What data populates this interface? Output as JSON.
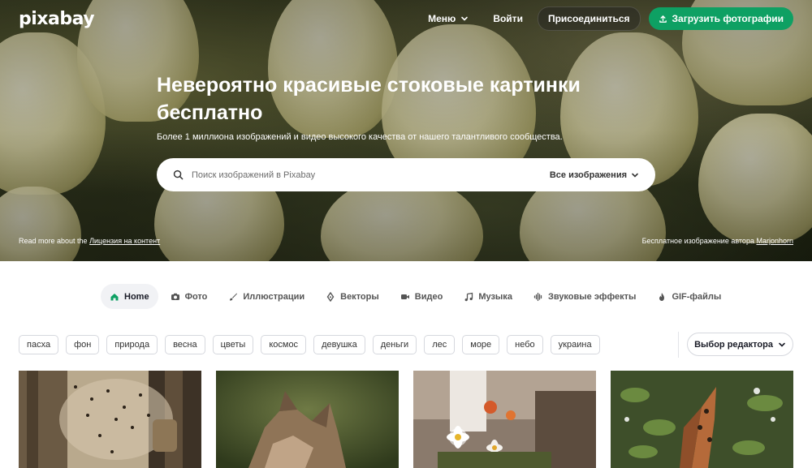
{
  "header": {
    "logo": "pixabay",
    "menu_label": "Меню",
    "login_label": "Войти",
    "join_label": "Присоединиться",
    "upload_label": "Загрузить фотографии"
  },
  "hero": {
    "title": "Невероятно красивые стоковые картинки бесплатно",
    "subtitle": "Более 1 миллиона изображений и видео высокого качества от нашего талантливого сообщества.",
    "credit_left_prefix": "Read more about the",
    "credit_left_link": "Лицензия на контент",
    "credit_right_prefix": "Бесплатное изображение автора",
    "credit_right_link": "Marjonhorn"
  },
  "search": {
    "placeholder": "Поиск изображений в Pixabay",
    "filter_label": "Все изображения"
  },
  "tabs": [
    {
      "label": "Home",
      "icon": "home-icon",
      "active": true
    },
    {
      "label": "Фото",
      "icon": "camera-icon"
    },
    {
      "label": "Иллюстрации",
      "icon": "brush-icon"
    },
    {
      "label": "Векторы",
      "icon": "pen-nib-icon"
    },
    {
      "label": "Видео",
      "icon": "video-icon"
    },
    {
      "label": "Музыка",
      "icon": "music-note-icon"
    },
    {
      "label": "Звуковые эффекты",
      "icon": "waveform-icon"
    },
    {
      "label": "GIF-файлы",
      "icon": "flame-icon"
    }
  ],
  "tags": [
    "пасха",
    "фон",
    "природа",
    "весна",
    "цветы",
    "космос",
    "девушка",
    "деньги",
    "лес",
    "море",
    "небо",
    "украина"
  ],
  "editor_choice_label": "Выбор редактора",
  "colors": {
    "accent_green": "#0ea063",
    "text_dark": "#191b26",
    "tab_active_bg": "#f1f2f5"
  }
}
